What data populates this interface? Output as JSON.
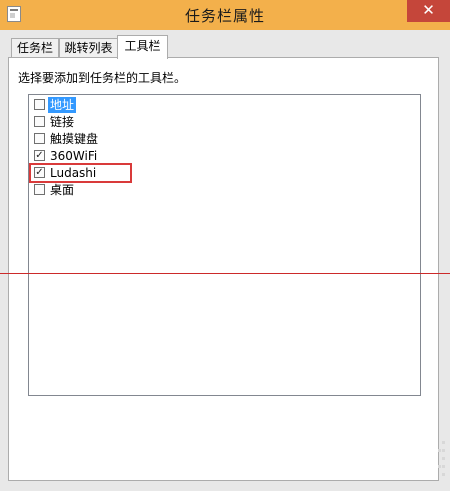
{
  "window": {
    "title": "任务栏属性",
    "close_glyph": "✕",
    "accent_color": "#f3b04b",
    "close_color": "#c5463a"
  },
  "tabs": [
    {
      "label": "任务栏",
      "active": false
    },
    {
      "label": "跳转列表",
      "active": false
    },
    {
      "label": "工具栏",
      "active": true
    }
  ],
  "toolbar_tab": {
    "instruction": "选择要添加到任务栏的工具栏。",
    "items": [
      {
        "label": "地址",
        "checked": false,
        "selected": true
      },
      {
        "label": "链接",
        "checked": false,
        "selected": false
      },
      {
        "label": "触摸键盘",
        "checked": false,
        "selected": false
      },
      {
        "label": "360WiFi",
        "checked": true,
        "selected": false
      },
      {
        "label": "Ludashi",
        "checked": true,
        "selected": false,
        "highlighted": true
      },
      {
        "label": "桌面",
        "checked": false,
        "selected": false
      }
    ]
  },
  "icons": {
    "app": "taskbar-properties-icon",
    "close": "close-icon",
    "check": "check-icon"
  },
  "glyphs": {
    "check": "✓"
  }
}
